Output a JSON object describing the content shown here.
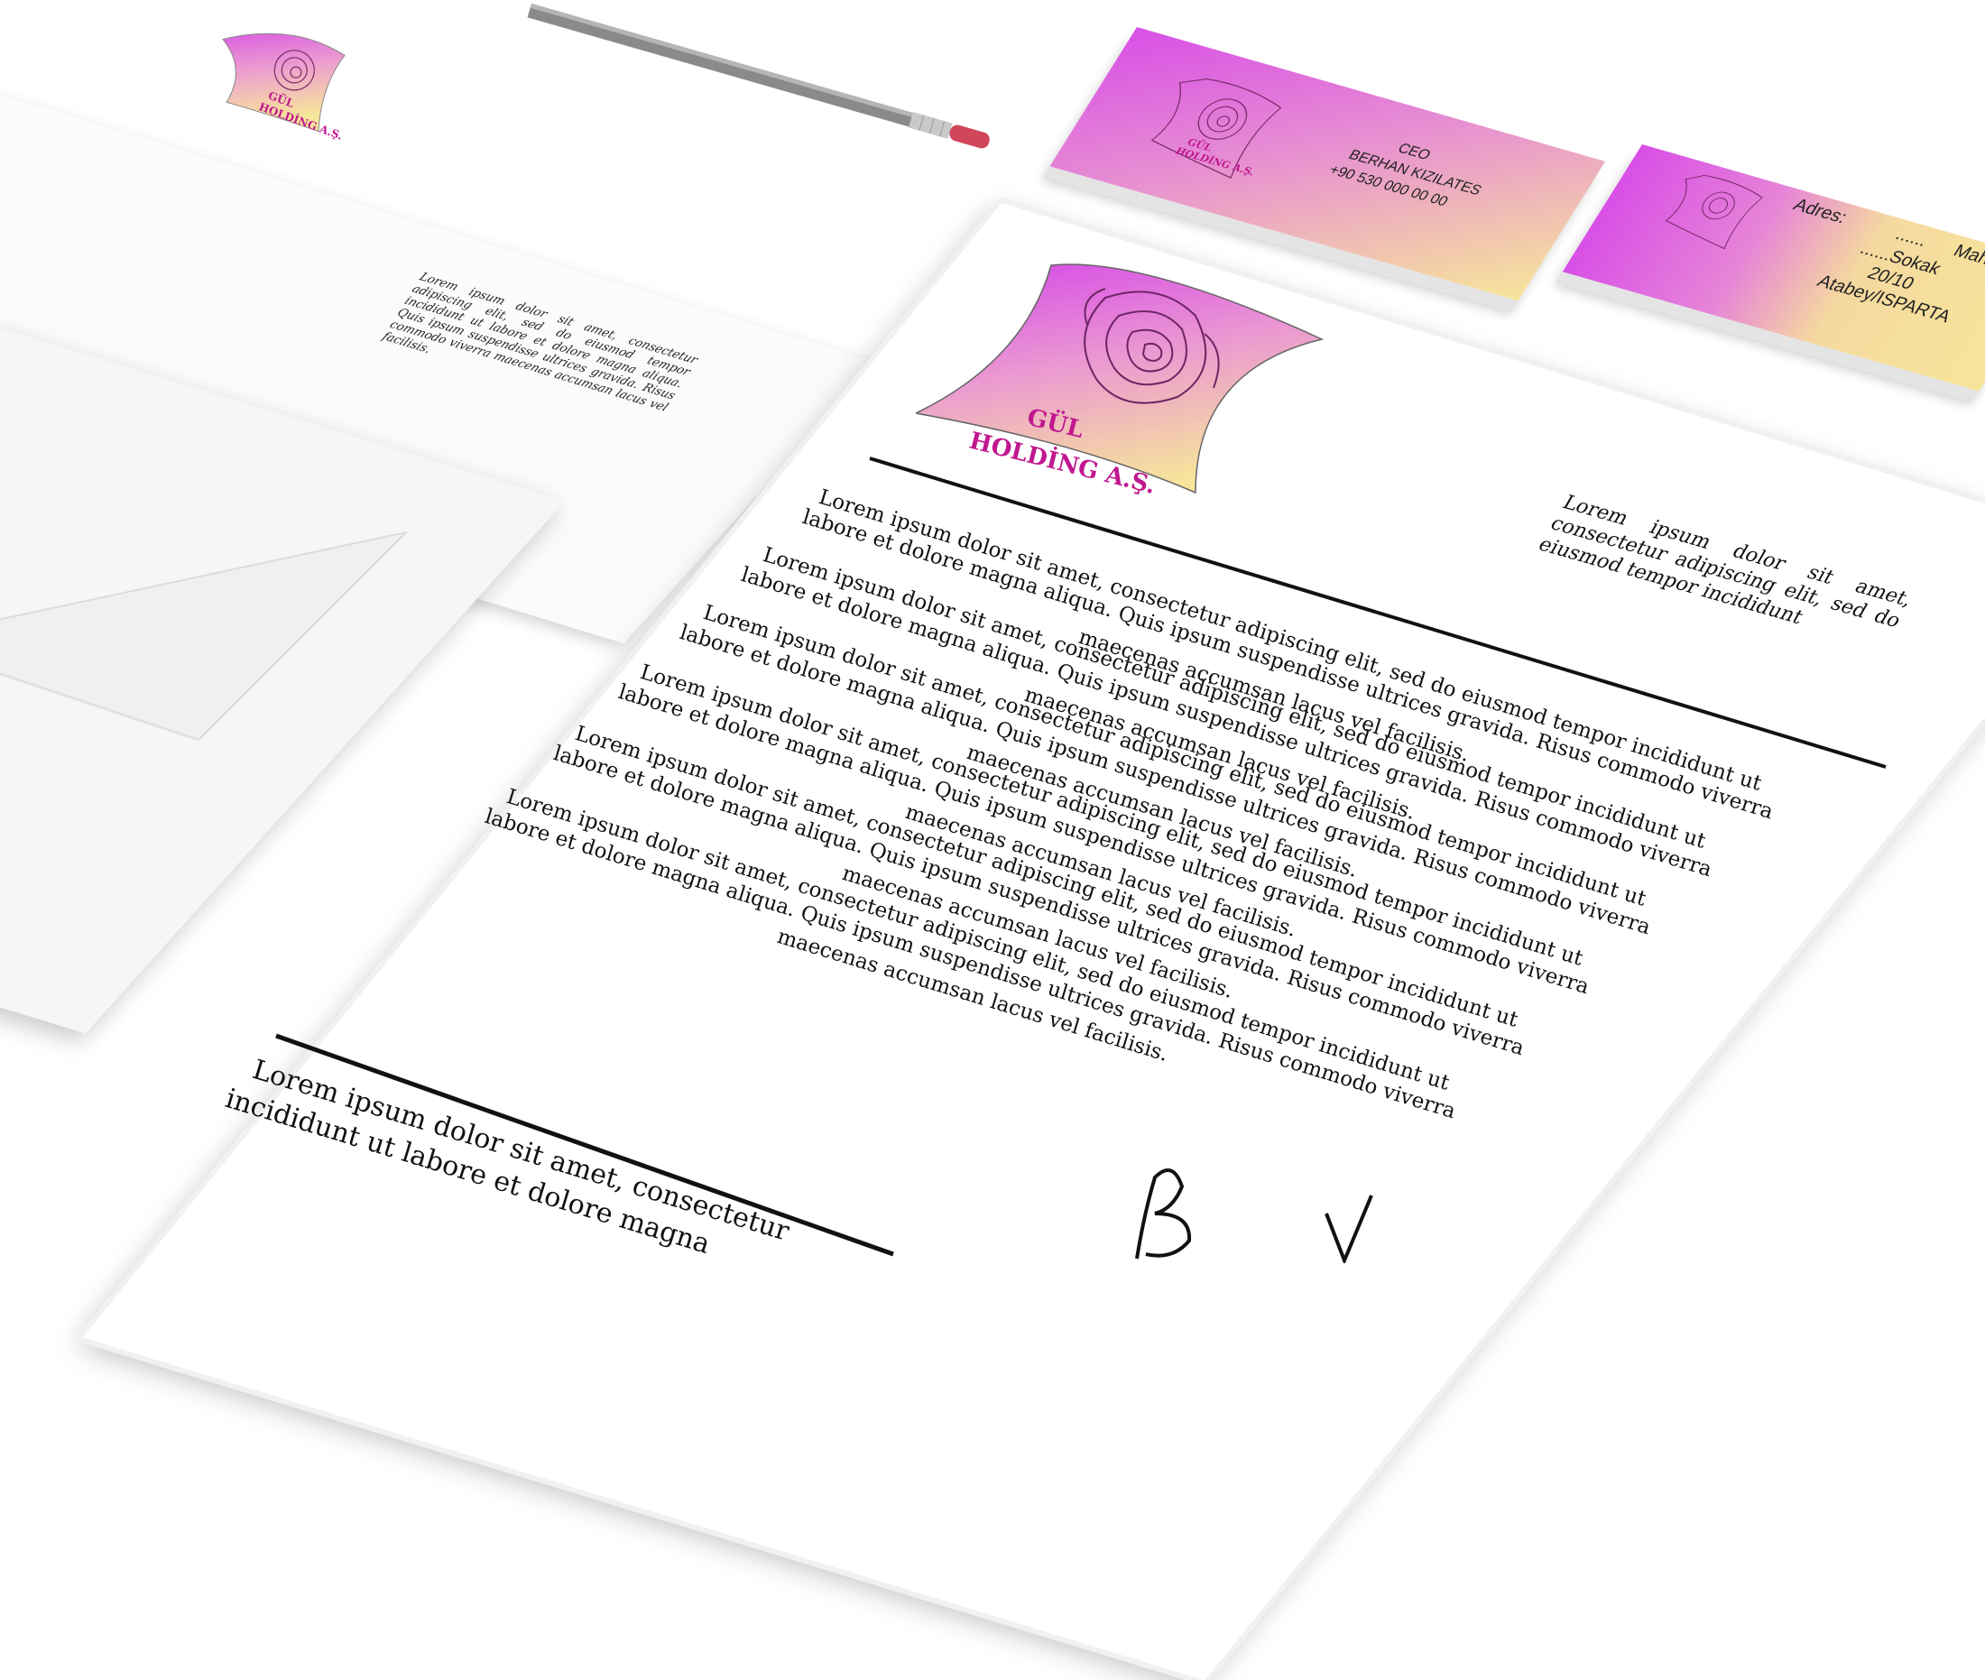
{
  "company": {
    "name_line1": "GÜL",
    "name_line2": "HOLDİNG A.Ş."
  },
  "business_card_front": {
    "title": "CEO",
    "name": "BERHAN KIZILATES",
    "phone": "+90 530 000 00 00"
  },
  "business_card_back": {
    "address_label": "Adres:",
    "line1": "......      Mahalle",
    "line2": "......Sokak",
    "line3": "20/10",
    "line4": "Atabey/ISPARTA"
  },
  "envelope": {
    "text": "Lorem ipsum dolor sit amet, consectetur adipiscing elit, sed do eiusmod tempor incididunt ut labore et dolore magna aliqua. Quis ipsum suspendisse ultrices gravida. Risus commodo viverra maecenas accumsan lacus vel facilisis."
  },
  "letterhead": {
    "side_note": "Lorem ipsum dolor sit amet, consectetur adipiscing elit, sed do eiusmod tempor incididunt",
    "paragraph_line1": "Lorem ipsum dolor sit amet, consectetur adipiscing elit, sed do eiusmod tempor incididunt ut",
    "paragraph_line2": "labore et dolore magna aliqua. Quis ipsum suspendisse ultrices gravida. Risus commodo viverra",
    "paragraph_line3": "maecenas accumsan lacus vel facilisis.",
    "footer_line1": "Lorem ipsum dolor sit amet, consectetur",
    "footer_line2": "incididunt ut labore et dolore magna"
  },
  "colors": {
    "brand_pink": "#d84fe6",
    "brand_yellow": "#f7e59a",
    "brand_text": "#c0178f"
  }
}
